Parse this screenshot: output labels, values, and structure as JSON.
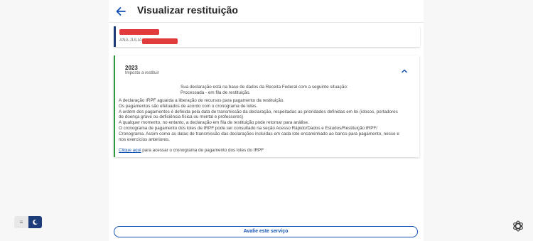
{
  "header": {
    "title": "Visualizar restituição",
    "back_icon": "arrow-left-icon"
  },
  "user": {
    "name_label": "ANA JULIA"
  },
  "declaration": {
    "year": "2023",
    "subtitle": "Imposto a restituir",
    "status_lines": [
      "Sua declaração está na base de dados da Receita Federal com a seguinte situação:",
      "Processada - em fila de restituição."
    ],
    "body_lines": [
      "A declaração IRPF aguarda a liberação de recursos para pagamento da restituição.",
      "Os pagamentos são efetuados de acordo com o cronograma de lotes.",
      "A ordem dos pagamentos é definida pela data de transmissão da declaração, respeitadas as prioridades definidas em lei (idosos, portadores",
      "de doença grave ou deficiência física ou mental e professores)",
      "A qualquer momento, no entanto, a declaração em fila de restituição pode retornar para análise.",
      "O cronograma de pagamento dos lotes de IRPF pode ser consultado na seção Acesso Rápido/Dados e Estudos/Restituição IRPF/",
      "Cronograma. Assim como as datas de transmissão das declarações incluídas em cada lote encaminhado ao banco para pagamento, nesse e",
      "nos exercícios anteriores."
    ],
    "link_text": "Clique aqui",
    "link_suffix": " para acessar o cronograma de pagamento dos lotes do IRPF",
    "chevron_icon": "chevron-up-icon"
  },
  "footer": {
    "rate_button": "Avalie este serviço",
    "menu_icon": "menu-icon",
    "theme_icon": "moon-icon",
    "assistant_icon": "openai-icon"
  },
  "colors": {
    "accent_blue": "#1351b4",
    "navy": "#1c3d7a",
    "success_green": "#2f9a3c",
    "redaction": "#e23b3b"
  }
}
